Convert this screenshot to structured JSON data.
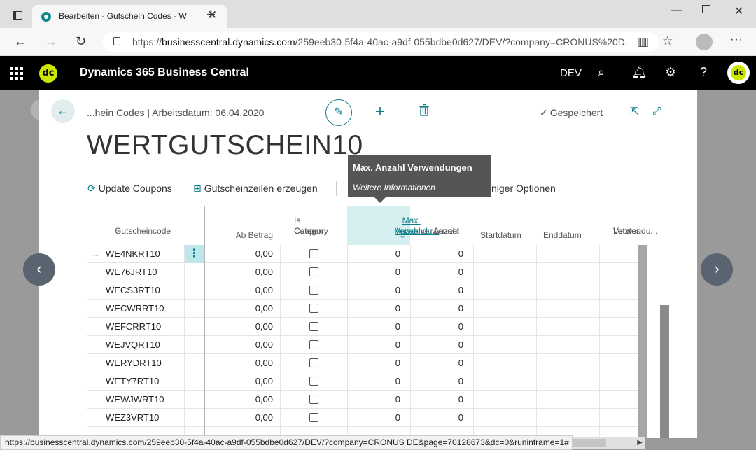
{
  "browser": {
    "tab_title": "Bearbeiten - Gutschein Codes - W",
    "url_prefix": "https://",
    "url_host": "businesscentral.dynamics.com",
    "url_rest": "/259eeb30-5f4a-40ac-a9df-055bdbe0d627/DEV/?company=CRONUS%20D...",
    "status_url": "https://businesscentral.dynamics.com/259eeb30-5f4a-40ac-a9df-055bdbe0d627/DEV/?company=CRONUS DE&page=70128673&dc=0&runinframe=1#"
  },
  "header": {
    "logo_text": "dc",
    "app_title": "Dynamics 365 Business Central",
    "environment": "DEV"
  },
  "card": {
    "breadcrumb": "...hein Codes | Arbeitsdatum: 06.04.2020",
    "saved_label": "Gespeichert",
    "title": "WERTGUTSCHEIN10"
  },
  "actions": {
    "update_coupons": "Update Coupons",
    "create_lines": "Gutscheinzeilen erzeugen",
    "fewer_options": "niger Optionen"
  },
  "tooltip": {
    "title": "Max. Anzahl Verwendungen",
    "link": "Weitere Informationen"
  },
  "columns": {
    "code": "Gutscheincode",
    "sort_indicator": "↑",
    "ab_betrag": "Ab Betrag",
    "is_category_1": "Is Category",
    "is_category_2": "Coupon",
    "max_uses_1": "Max. Anzahl",
    "max_uses_2": "Verwendu...",
    "used_1": "Anzahl",
    "used_2": "verwendet",
    "start": "Startdatum",
    "end": "Enddatum",
    "last_1": "Letztes",
    "last_2": "Verwendu..."
  },
  "rows": [
    {
      "code": "WE4NKRT10",
      "ab_betrag": "0,00",
      "max": "0",
      "used": "0"
    },
    {
      "code": "WE76JRT10",
      "ab_betrag": "0,00",
      "max": "0",
      "used": "0"
    },
    {
      "code": "WECS3RT10",
      "ab_betrag": "0,00",
      "max": "0",
      "used": "0"
    },
    {
      "code": "WECWRRT10",
      "ab_betrag": "0,00",
      "max": "0",
      "used": "0"
    },
    {
      "code": "WEFCRRT10",
      "ab_betrag": "0,00",
      "max": "0",
      "used": "0"
    },
    {
      "code": "WEJVQRT10",
      "ab_betrag": "0,00",
      "max": "0",
      "used": "0"
    },
    {
      "code": "WERYDRT10",
      "ab_betrag": "0,00",
      "max": "0",
      "used": "0"
    },
    {
      "code": "WETY7RT10",
      "ab_betrag": "0,00",
      "max": "0",
      "used": "0"
    },
    {
      "code": "WEWJWRT10",
      "ab_betrag": "0,00",
      "max": "0",
      "used": "0"
    },
    {
      "code": "WEZ3VRT10",
      "ab_betrag": "0,00",
      "max": "0",
      "used": "0"
    }
  ]
}
